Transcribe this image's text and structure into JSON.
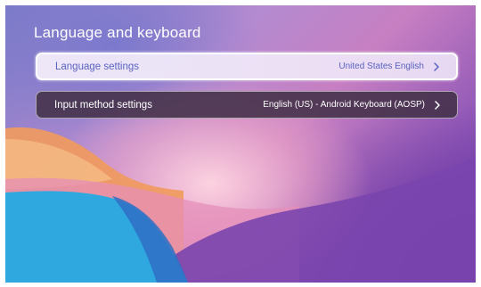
{
  "screen": {
    "title": "Language and keyboard"
  },
  "settings": {
    "items": [
      {
        "label": "Language settings",
        "value": "United States English",
        "icon": "chevron-right-icon"
      },
      {
        "label": "Input method settings",
        "value": "English (US) - Android Keyboard (AOSP)",
        "icon": "chevron-right-icon"
      }
    ]
  },
  "colors": {
    "focused_text": "#5a63c0",
    "focused_background": "#f3ecfa",
    "row_background": "#423048",
    "title_text": "#ffffff"
  }
}
